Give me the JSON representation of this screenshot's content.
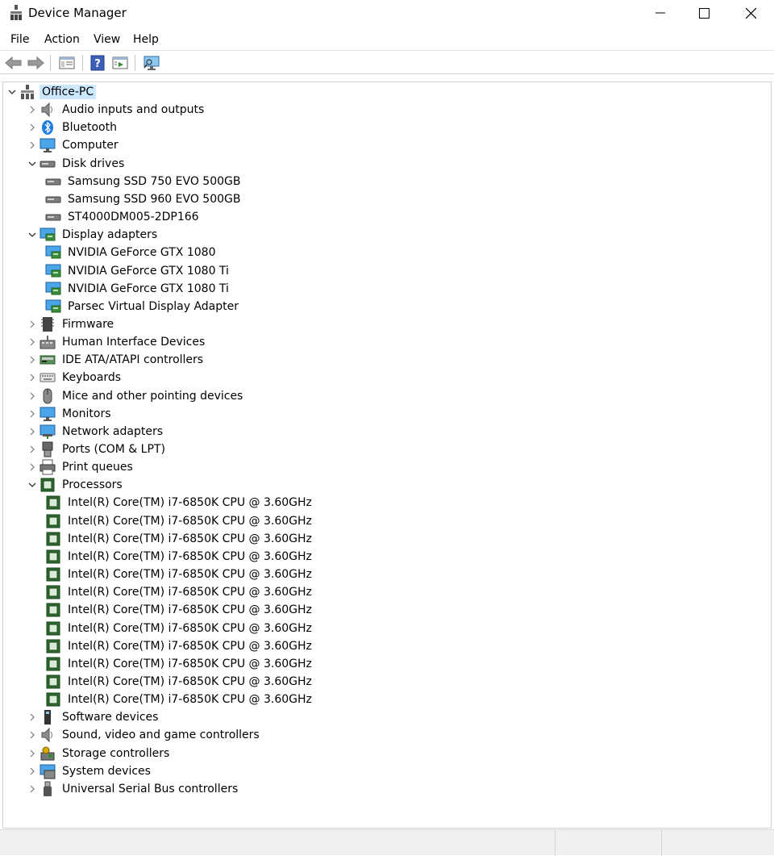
{
  "window": {
    "title": "Device Manager"
  },
  "menu": {
    "items": [
      "File",
      "Action",
      "View",
      "Help"
    ]
  },
  "toolbar": {
    "buttons": [
      "back-icon",
      "forward-icon",
      "properties-icon",
      "help-icon",
      "update-driver-icon",
      "scan-hardware-icon"
    ]
  },
  "tree": {
    "root": "Office-PC",
    "categories": {
      "audio": "Audio inputs and outputs",
      "bluetooth": "Bluetooth",
      "computer": "Computer",
      "disk": "Disk drives",
      "display": "Display adapters",
      "firmware": "Firmware",
      "hid": "Human Interface Devices",
      "ide": "IDE ATA/ATAPI controllers",
      "keyboards": "Keyboards",
      "mice": "Mice and other pointing devices",
      "monitors": "Monitors",
      "network": "Network adapters",
      "ports": "Ports (COM & LPT)",
      "print": "Print queues",
      "processors": "Processors",
      "software": "Software devices",
      "sound": "Sound, video and game controllers",
      "storage": "Storage controllers",
      "system": "System devices",
      "usb": "Universal Serial Bus controllers"
    },
    "disk_drives": [
      "Samsung SSD 750 EVO 500GB",
      "Samsung SSD 960 EVO 500GB",
      "ST4000DM005-2DP166"
    ],
    "display_adapters": [
      "NVIDIA GeForce GTX 1080",
      "NVIDIA GeForce GTX 1080 Ti",
      "NVIDIA GeForce GTX 1080 Ti",
      "Parsec Virtual Display Adapter"
    ],
    "processors": [
      "Intel(R) Core(TM) i7-6850K CPU @ 3.60GHz",
      "Intel(R) Core(TM) i7-6850K CPU @ 3.60GHz",
      "Intel(R) Core(TM) i7-6850K CPU @ 3.60GHz",
      "Intel(R) Core(TM) i7-6850K CPU @ 3.60GHz",
      "Intel(R) Core(TM) i7-6850K CPU @ 3.60GHz",
      "Intel(R) Core(TM) i7-6850K CPU @ 3.60GHz",
      "Intel(R) Core(TM) i7-6850K CPU @ 3.60GHz",
      "Intel(R) Core(TM) i7-6850K CPU @ 3.60GHz",
      "Intel(R) Core(TM) i7-6850K CPU @ 3.60GHz",
      "Intel(R) Core(TM) i7-6850K CPU @ 3.60GHz",
      "Intel(R) Core(TM) i7-6850K CPU @ 3.60GHz",
      "Intel(R) Core(TM) i7-6850K CPU @ 3.60GHz"
    ]
  },
  "colors": {
    "selection": "#cce8ff",
    "chip_green": "#2e6b2e",
    "monitor_blue": "#3a9ee0"
  }
}
